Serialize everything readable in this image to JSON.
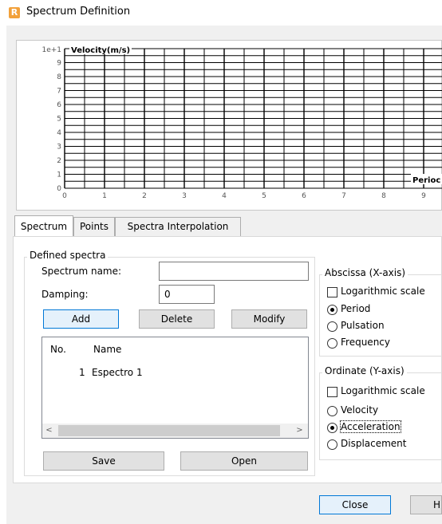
{
  "window": {
    "title": "Spectrum Definition",
    "icon_letter": "R"
  },
  "chart": {
    "ylabel": "Velocity(m/s)",
    "xlabel": "Perioc",
    "y_exponent": "1e+1",
    "y_ticks": [
      "9",
      "8",
      "7",
      "6",
      "5",
      "4",
      "3",
      "2",
      "1",
      "0"
    ],
    "x_ticks": [
      "0",
      "1",
      "2",
      "3",
      "4",
      "5",
      "6",
      "7",
      "8",
      "9"
    ]
  },
  "chart_data": {
    "type": "line",
    "ylabel": "Velocity(m/s)",
    "xlabel": "Perioc",
    "xlim": [
      0,
      9
    ],
    "ylim": [
      0,
      10
    ],
    "grid": true,
    "series": []
  },
  "tabs": [
    {
      "label": "Spectrum",
      "active": true
    },
    {
      "label": "Points",
      "active": false
    },
    {
      "label": "Spectra Interpolation",
      "active": false
    }
  ],
  "defined": {
    "group_label": "Defined spectra",
    "name_label": "Spectrum name:",
    "name_value": "",
    "damping_label": "Damping:",
    "damping_value": "0",
    "add": "Add",
    "delete": "Delete",
    "modify": "Modify",
    "col_no": "No.",
    "col_name": "Name",
    "rows": [
      {
        "no": "1",
        "name": "Espectro 1"
      }
    ],
    "scroll_left": "<",
    "scroll_right": ">",
    "save": "Save",
    "open": "Open"
  },
  "abscissa": {
    "label": "Abscissa (X-axis)",
    "log": "Logarithmic scale",
    "options": [
      "Period",
      "Pulsation",
      "Frequency"
    ],
    "selected": "Period"
  },
  "ordinate": {
    "label": "Ordinate (Y-axis)",
    "log": "Logarithmic scale",
    "options": [
      "Velocity",
      "Acceleration",
      "Displacement"
    ],
    "selected": "Acceleration"
  },
  "footer": {
    "close": "Close",
    "help": "H"
  }
}
